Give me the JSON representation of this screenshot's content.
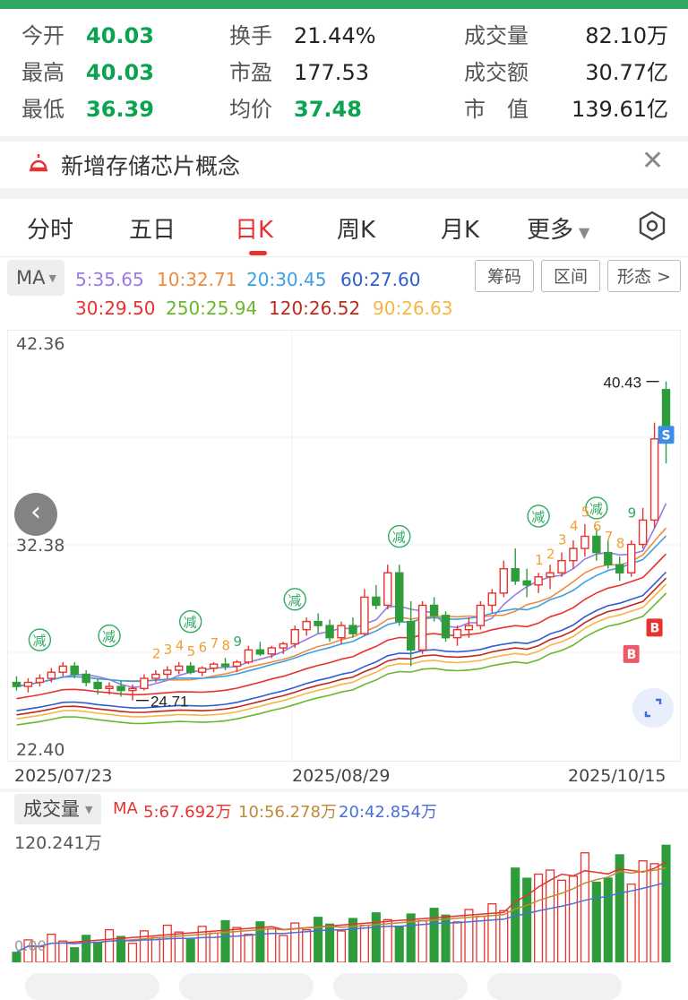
{
  "quote": {
    "rows": [
      {
        "l1": "今开",
        "v1": "40.03",
        "l2": "换手",
        "v2": "21.44%",
        "l3": "成交量",
        "v3": "82.10万"
      },
      {
        "l1": "最高",
        "v1": "40.03",
        "l2": "市盈",
        "v2": "177.53",
        "l3": "成交额",
        "v3": "30.77亿"
      },
      {
        "l1": "最低",
        "v1": "36.39",
        "l2": "均价",
        "v2": "37.48",
        "l3": "市　值",
        "v3": "139.61亿"
      }
    ]
  },
  "concept": {
    "label": "新增存储芯片概念"
  },
  "tabs": [
    "分时",
    "五日",
    "日K",
    "周K",
    "月K",
    "更多"
  ],
  "active_tab": "日K",
  "ma_selector": "MA",
  "ma_values": [
    {
      "label": "5:35.65",
      "color": "#9a7ae6"
    },
    {
      "label": "10:32.71",
      "color": "#f08a3c"
    },
    {
      "label": "20:30.45",
      "color": "#3aa0e6"
    },
    {
      "label": "60:27.60",
      "color": "#2f5bd3"
    },
    {
      "label": "30:29.50",
      "color": "#e8322e"
    },
    {
      "label": "250:25.94",
      "color": "#69b82c"
    },
    {
      "label": "120:26.52",
      "color": "#c0281e"
    },
    {
      "label": "90:26.63",
      "color": "#f5b642"
    }
  ],
  "tools": {
    "chips": "筹码",
    "range": "区间",
    "pattern": "形态 >"
  },
  "price_axis": {
    "top": "42.36",
    "mid": "32.38",
    "bottom": "22.40"
  },
  "dates": {
    "start": "2025/07/23",
    "mid": "2025/08/29",
    "end": "2025/10/15"
  },
  "annotations": {
    "high": "40.43",
    "low": "24.71",
    "reduce": "减",
    "buy": "B",
    "sell": "S",
    "seq_a": [
      "2",
      "3",
      "4",
      "5",
      "6",
      "7",
      "8",
      "9"
    ],
    "seq_b": [
      "1",
      "2",
      "3",
      "4",
      "5",
      "6",
      "7",
      "8",
      "9"
    ]
  },
  "volume": {
    "selector": "成交量",
    "ma_prefix": "MA",
    "v5": "5:67.692万",
    "v10": "10:56.278万",
    "v20": "20:42.854万",
    "max_label": "120.241万",
    "zero_label": "0.00"
  },
  "colors": {
    "up": "#e8322e",
    "down": "#2e9c3a",
    "accent": "#e63232",
    "green_text": "#0aa34f"
  },
  "chart_data": {
    "type": "candlestick",
    "ylim": [
      22.4,
      42.36
    ],
    "candles": [
      [
        25.6,
        25.9,
        25.2,
        25.4
      ],
      [
        25.4,
        25.8,
        25.1,
        25.6
      ],
      [
        25.6,
        26.0,
        25.4,
        25.8
      ],
      [
        25.8,
        26.3,
        25.6,
        26.1
      ],
      [
        26.1,
        26.6,
        25.9,
        26.4
      ],
      [
        26.4,
        26.6,
        25.8,
        26.0
      ],
      [
        26.0,
        26.2,
        25.4,
        25.6
      ],
      [
        25.6,
        25.8,
        25.0,
        25.3
      ],
      [
        25.3,
        25.6,
        25.0,
        25.4
      ],
      [
        25.4,
        25.7,
        24.9,
        25.2
      ],
      [
        25.2,
        25.5,
        24.71,
        25.3
      ],
      [
        25.3,
        26.0,
        25.2,
        25.8
      ],
      [
        25.8,
        26.2,
        25.6,
        26.0
      ],
      [
        26.0,
        26.4,
        25.8,
        26.2
      ],
      [
        26.2,
        26.6,
        26.0,
        26.4
      ],
      [
        26.4,
        26.6,
        26.0,
        26.1
      ],
      [
        26.1,
        26.4,
        25.9,
        26.3
      ],
      [
        26.3,
        26.6,
        26.1,
        26.5
      ],
      [
        26.5,
        26.8,
        26.2,
        26.4
      ],
      [
        26.4,
        26.7,
        26.1,
        26.6
      ],
      [
        26.6,
        27.4,
        26.5,
        27.2
      ],
      [
        27.2,
        27.6,
        26.9,
        27.0
      ],
      [
        27.0,
        27.4,
        26.8,
        27.3
      ],
      [
        27.3,
        27.6,
        27.0,
        27.5
      ],
      [
        27.5,
        28.4,
        27.3,
        28.2
      ],
      [
        28.2,
        28.8,
        27.9,
        28.6
      ],
      [
        28.6,
        29.0,
        28.0,
        28.4
      ],
      [
        28.4,
        28.7,
        27.6,
        27.8
      ],
      [
        27.8,
        28.6,
        27.5,
        28.4
      ],
      [
        28.4,
        28.8,
        27.8,
        28.0
      ],
      [
        28.0,
        30.2,
        27.9,
        29.8
      ],
      [
        29.8,
        30.4,
        29.2,
        29.4
      ],
      [
        29.4,
        31.4,
        29.2,
        31.0
      ],
      [
        31.0,
        31.4,
        28.4,
        28.6
      ],
      [
        28.6,
        29.6,
        26.4,
        27.2
      ],
      [
        27.2,
        29.6,
        27.0,
        29.4
      ],
      [
        29.4,
        29.8,
        28.6,
        28.9
      ],
      [
        28.9,
        29.1,
        27.6,
        27.8
      ],
      [
        27.8,
        28.4,
        27.4,
        28.2
      ],
      [
        28.2,
        28.8,
        27.8,
        28.4
      ],
      [
        28.4,
        29.6,
        28.2,
        29.4
      ],
      [
        29.4,
        30.2,
        29.0,
        30.0
      ],
      [
        30.0,
        31.6,
        29.8,
        31.2
      ],
      [
        31.2,
        32.2,
        30.4,
        30.6
      ],
      [
        30.6,
        31.2,
        29.8,
        30.4
      ],
      [
        30.4,
        31.0,
        30.0,
        30.8
      ],
      [
        30.8,
        31.4,
        30.2,
        31.0
      ],
      [
        31.0,
        32.0,
        30.8,
        31.6
      ],
      [
        31.6,
        32.6,
        31.2,
        32.2
      ],
      [
        32.2,
        33.4,
        31.8,
        32.8
      ],
      [
        32.8,
        33.2,
        31.6,
        32.0
      ],
      [
        32.0,
        32.6,
        31.2,
        31.4
      ],
      [
        31.4,
        31.8,
        30.6,
        31.0
      ],
      [
        31.0,
        32.6,
        30.8,
        32.4
      ],
      [
        32.4,
        34.2,
        32.2,
        33.6
      ],
      [
        33.6,
        38.4,
        33.2,
        37.6
      ],
      [
        40.03,
        40.43,
        36.39,
        37.48
      ]
    ]
  }
}
